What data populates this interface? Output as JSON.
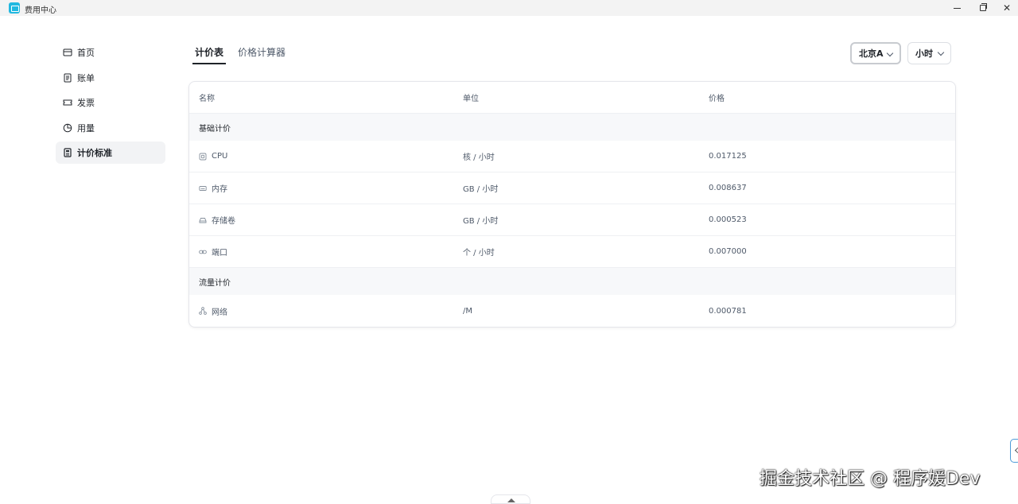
{
  "window": {
    "title": "费用中心"
  },
  "sidebar": {
    "items": [
      {
        "label": "首页",
        "icon": "card-icon"
      },
      {
        "label": "账单",
        "icon": "document-icon"
      },
      {
        "label": "发票",
        "icon": "ticket-icon"
      },
      {
        "label": "用量",
        "icon": "pie-chart-icon"
      },
      {
        "label": "计价标准",
        "icon": "price-list-icon",
        "active": true
      }
    ]
  },
  "tabs": [
    {
      "label": "计价表",
      "active": true
    },
    {
      "label": "价格计算器",
      "active": false
    }
  ],
  "filters": {
    "region": "北京A",
    "unit": "小时"
  },
  "table": {
    "headers": [
      "名称",
      "单位",
      "价格"
    ],
    "sections": [
      {
        "title": "基础计价",
        "rows": [
          {
            "name": "CPU",
            "icon": "chip-icon",
            "unit": "核 / 小时",
            "price": "0.017125"
          },
          {
            "name": "内存",
            "icon": "memory-icon",
            "unit": "GB / 小时",
            "price": "0.008637"
          },
          {
            "name": "存储卷",
            "icon": "disk-icon",
            "unit": "GB / 小时",
            "price": "0.000523"
          },
          {
            "name": "端口",
            "icon": "link-icon",
            "unit": "个 / 小时",
            "price": "0.007000"
          }
        ]
      },
      {
        "title": "流量计价",
        "rows": [
          {
            "name": "网络",
            "icon": "network-icon",
            "unit": "/M",
            "price": "0.000781"
          }
        ]
      }
    ]
  },
  "watermark": "掘金技术社区 @ 程序媛Dev"
}
